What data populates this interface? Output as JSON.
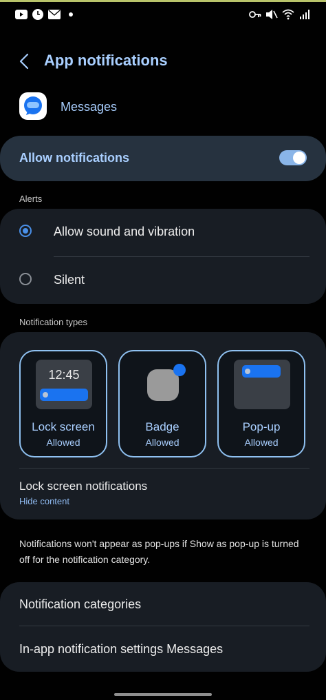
{
  "colors": {
    "background": "#010101",
    "accent": "#a9cfff",
    "card": "#181d24",
    "highlight_card": "#26323f",
    "switch_on": "#8ab5e8",
    "notification_blue": "#1a73f0"
  },
  "status_bar": {
    "left_icons": [
      "youtube-icon",
      "clock-icon",
      "mail-icon",
      "dot-icon"
    ],
    "right_icons": [
      "key-icon",
      "mute-icon",
      "wifi-icon",
      "signal-icon"
    ]
  },
  "header": {
    "back_icon": "chevron-left-icon",
    "title": "App notifications"
  },
  "app": {
    "icon": "messages-icon",
    "name": "Messages"
  },
  "allow": {
    "label": "Allow notifications",
    "enabled": true
  },
  "alerts": {
    "section_label": "Alerts",
    "options": [
      {
        "label": "Allow sound and vibration",
        "selected": true
      },
      {
        "label": "Silent",
        "selected": false
      }
    ]
  },
  "notification_types": {
    "section_label": "Notification types",
    "tiles": [
      {
        "title": "Lock screen",
        "status": "Allowed",
        "preview_time": "12:45"
      },
      {
        "title": "Badge",
        "status": "Allowed"
      },
      {
        "title": "Pop-up",
        "status": "Allowed"
      }
    ],
    "lock_screen": {
      "title": "Lock screen notifications",
      "value": "Hide content"
    }
  },
  "note": "Notifications won't appear as pop-ups if Show as pop-up is turned off for the notification category.",
  "more": {
    "items": [
      "Notification categories",
      "In-app notification settings Messages"
    ]
  }
}
